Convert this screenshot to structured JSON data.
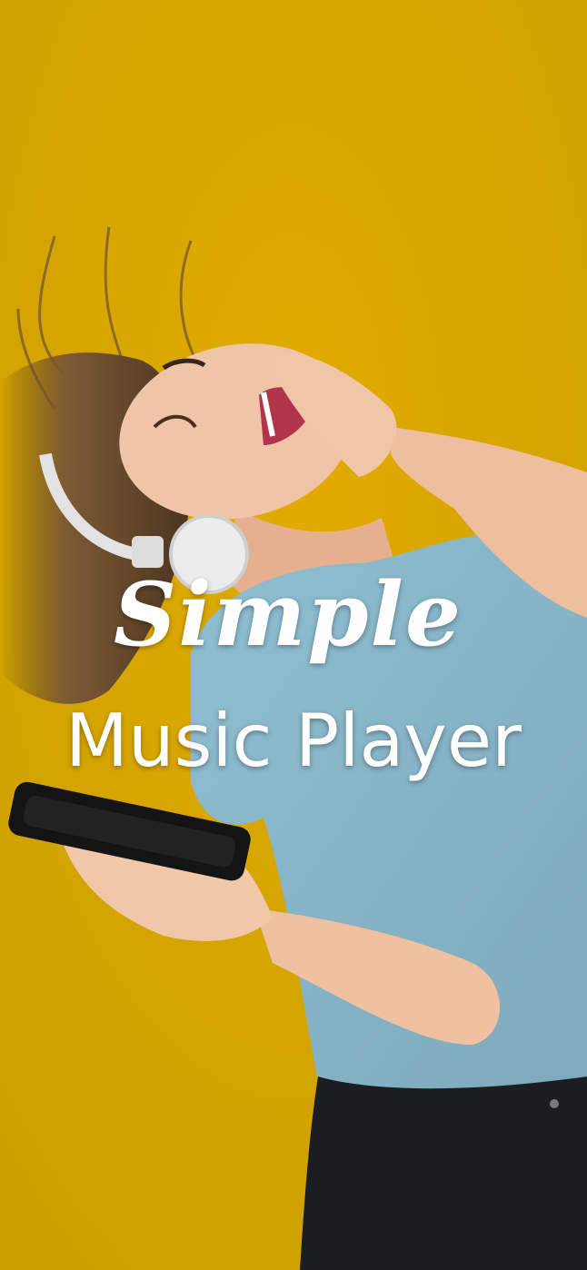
{
  "splash": {
    "title_script": "Simple",
    "title_sub": "Music Player"
  },
  "background": {
    "scene": "woman-with-headphones-photo",
    "color": "#d6a200"
  },
  "colors": {
    "wall": "#d6a200",
    "shirt": "#8fb6c9",
    "skin": "#efc1a1",
    "hair": "#7a5a38",
    "pants": "#1c1d22",
    "headphones": "#e8e8e8",
    "text": "#ffffff"
  }
}
